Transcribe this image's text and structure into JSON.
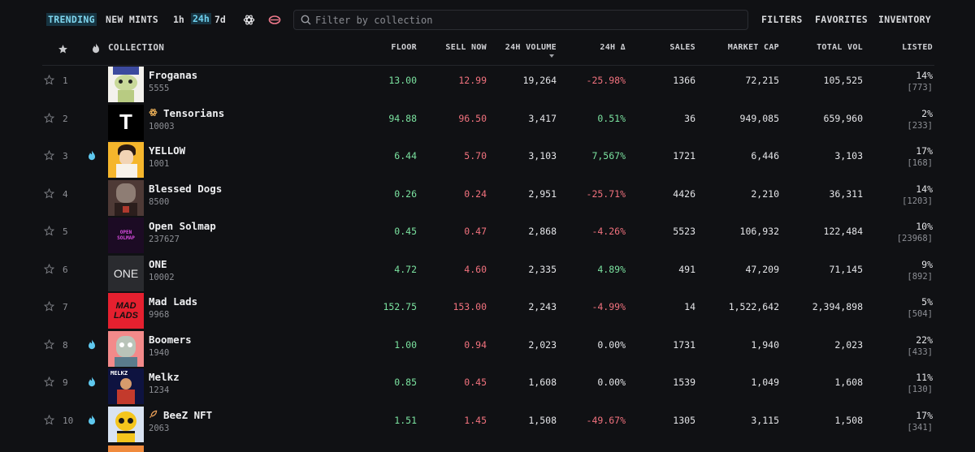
{
  "topbar": {
    "tabs": [
      "TRENDING",
      "NEW MINTS"
    ],
    "active_tab": "TRENDING",
    "time_periods": [
      "1h",
      "24h",
      "7d"
    ],
    "active_period": "24h",
    "icons": [
      "tensor-icon",
      "mode-toggle-icon"
    ],
    "search": {
      "placeholder": "Filter by collection",
      "value": ""
    },
    "nav": [
      "FILTERS",
      "FAVORITES",
      "INVENTORY"
    ]
  },
  "table": {
    "columns": {
      "collection": "COLLECTION",
      "floor": "FLOOR",
      "sell_now": "SELL NOW",
      "volume_24h": "24H VOLUME",
      "change_24h": "24H Δ",
      "sales": "SALES",
      "market_cap": "MARKET CAP",
      "total_vol": "TOTAL VOL",
      "listed": "LISTED"
    },
    "sorted_by": "24H VOLUME",
    "rows": [
      {
        "rank": "1",
        "trending": false,
        "name": "Froganas",
        "supply": "5555",
        "floor": "13.00",
        "sell_now": "12.99",
        "volume": "19,264",
        "change": "-25.98%",
        "change_dir": "down",
        "sales": "1366",
        "market_cap": "72,215",
        "total_vol": "105,525",
        "listed_pct": "14%",
        "listed_count": "[773]",
        "badge": ""
      },
      {
        "rank": "2",
        "trending": false,
        "name": "Tensorians",
        "supply": "10003",
        "floor": "94.88",
        "sell_now": "96.50",
        "volume": "3,417",
        "change": "0.51%",
        "change_dir": "up",
        "sales": "36",
        "market_cap": "949,085",
        "total_vol": "659,960",
        "listed_pct": "2%",
        "listed_count": "[233]",
        "badge": "tensor-icon"
      },
      {
        "rank": "3",
        "trending": true,
        "name": "YELLOW",
        "supply": "1001",
        "floor": "6.44",
        "sell_now": "5.70",
        "volume": "3,103",
        "change": "7,567%",
        "change_dir": "up",
        "sales": "1721",
        "market_cap": "6,446",
        "total_vol": "3,103",
        "listed_pct": "17%",
        "listed_count": "[168]",
        "badge": ""
      },
      {
        "rank": "4",
        "trending": false,
        "name": "Blessed Dogs",
        "supply": "8500",
        "floor": "0.26",
        "sell_now": "0.24",
        "volume": "2,951",
        "change": "-25.71%",
        "change_dir": "down",
        "sales": "4426",
        "market_cap": "2,210",
        "total_vol": "36,311",
        "listed_pct": "14%",
        "listed_count": "[1203]",
        "badge": ""
      },
      {
        "rank": "5",
        "trending": false,
        "name": "Open Solmap",
        "supply": "237627",
        "floor": "0.45",
        "sell_now": "0.47",
        "volume": "2,868",
        "change": "-4.26%",
        "change_dir": "down",
        "sales": "5523",
        "market_cap": "106,932",
        "total_vol": "122,484",
        "listed_pct": "10%",
        "listed_count": "[23968]",
        "badge": ""
      },
      {
        "rank": "6",
        "trending": false,
        "name": "ONE",
        "supply": "10002",
        "floor": "4.72",
        "sell_now": "4.60",
        "volume": "2,335",
        "change": "4.89%",
        "change_dir": "up",
        "sales": "491",
        "market_cap": "47,209",
        "total_vol": "71,145",
        "listed_pct": "9%",
        "listed_count": "[892]",
        "badge": ""
      },
      {
        "rank": "7",
        "trending": false,
        "name": "Mad Lads",
        "supply": "9968",
        "floor": "152.75",
        "sell_now": "153.00",
        "volume": "2,243",
        "change": "-4.99%",
        "change_dir": "down",
        "sales": "14",
        "market_cap": "1,522,642",
        "total_vol": "2,394,898",
        "listed_pct": "5%",
        "listed_count": "[504]",
        "badge": ""
      },
      {
        "rank": "8",
        "trending": true,
        "name": "Boomers",
        "supply": "1940",
        "floor": "1.00",
        "sell_now": "0.94",
        "volume": "2,023",
        "change": "0.00%",
        "change_dir": "flat",
        "sales": "1731",
        "market_cap": "1,940",
        "total_vol": "2,023",
        "listed_pct": "22%",
        "listed_count": "[433]",
        "badge": ""
      },
      {
        "rank": "9",
        "trending": true,
        "name": "Melkz",
        "supply": "1234",
        "floor": "0.85",
        "sell_now": "0.45",
        "volume": "1,608",
        "change": "0.00%",
        "change_dir": "flat",
        "sales": "1539",
        "market_cap": "1,049",
        "total_vol": "1,608",
        "listed_pct": "11%",
        "listed_count": "[130]",
        "badge": ""
      },
      {
        "rank": "10",
        "trending": true,
        "name": "BeeZ NFT",
        "supply": "2063",
        "floor": "1.51",
        "sell_now": "1.45",
        "volume": "1,508",
        "change": "-49.67%",
        "change_dir": "down",
        "sales": "1305",
        "market_cap": "3,115",
        "total_vol": "1,508",
        "listed_pct": "17%",
        "listed_count": "[341]",
        "badge": "rocket-icon"
      }
    ]
  },
  "thumb_text": {
    "one": "ONE",
    "tensor": "T",
    "solmap_1": "OPEN",
    "solmap_2": "SOLMAP",
    "madlads_1": "MAD",
    "madlads_2": "LADS",
    "melkz": "MELKZ"
  },
  "colors": {
    "background": "#101114",
    "up": "#7be3a0",
    "down": "#f2727e",
    "accent": "#6fd0ee",
    "flame": "#5ec8ee"
  }
}
